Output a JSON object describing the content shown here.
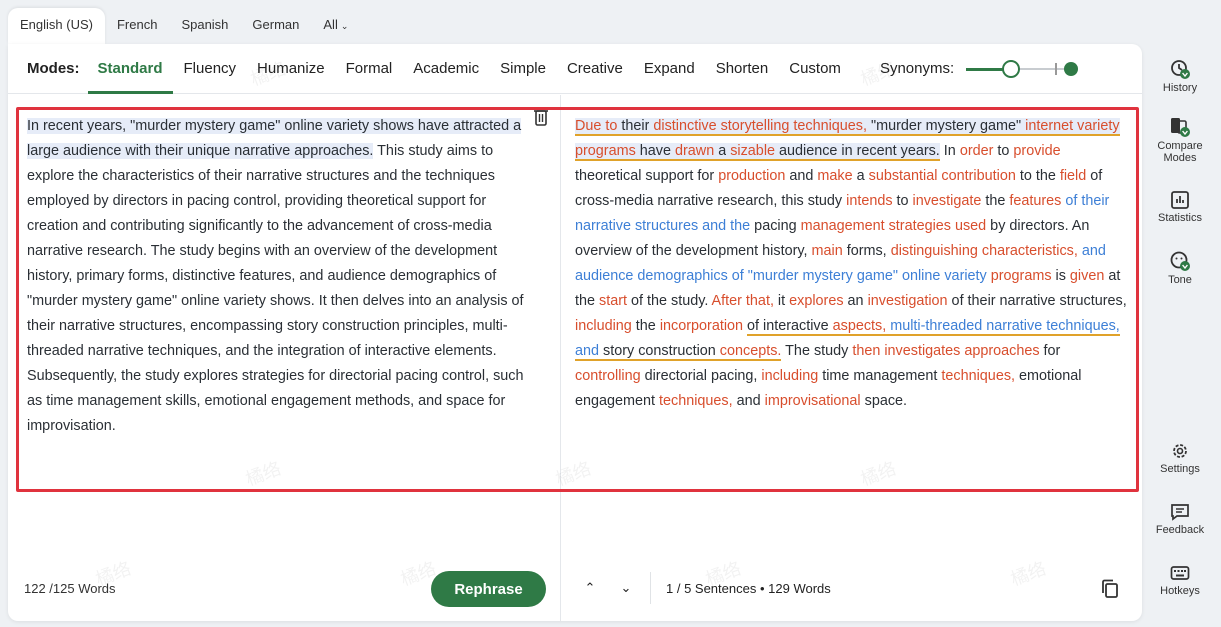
{
  "language_tabs": {
    "items": [
      "English (US)",
      "French",
      "Spanish",
      "German"
    ],
    "all_label": "All"
  },
  "modes": {
    "label": "Modes:",
    "items": [
      "Standard",
      "Fluency",
      "Humanize",
      "Formal",
      "Academic",
      "Simple",
      "Creative",
      "Expand",
      "Shorten",
      "Custom"
    ],
    "synonyms_label": "Synonyms:",
    "synonyms_level": 0.4
  },
  "input": {
    "highlight": "In recent years, \"murder mystery game\" online variety shows have attracted a large audience with their unique narrative approaches.",
    "rest": " This study aims to explore the characteristics of their narrative structures and the techniques employed by directors in pacing control, providing theoretical support for creation and contributing significantly to the advancement of cross-media narrative research. The study begins with an overview of the development history, primary forms, distinctive features, and audience demographics of \"murder mystery game\" online variety shows. It then delves into an analysis of their narrative structures, encompassing story construction principles, multi-threaded narrative techniques, and the integration of interactive elements. Subsequently, the study explores strategies for directorial pacing control, such as time management skills, emotional engagement methods, and space for improvisation.",
    "word_count": "122 /125 Words"
  },
  "output_segments": [
    [
      "Due to",
      "c",
      1
    ],
    [
      " ",
      "",
      1
    ],
    [
      "their",
      "",
      1
    ],
    [
      " ",
      "",
      1
    ],
    [
      "distinctive storytelling techniques,",
      "c",
      1
    ],
    [
      " ",
      "",
      1
    ],
    [
      "\"murder mystery game\"",
      "",
      1
    ],
    [
      " ",
      "",
      1
    ],
    [
      "internet variety",
      "c",
      1
    ],
    [
      " ",
      "",
      1
    ],
    [
      "programs",
      "c",
      1
    ],
    [
      " ",
      "",
      1
    ],
    [
      "have",
      "",
      1
    ],
    [
      " ",
      "",
      1
    ],
    [
      "drawn",
      "c",
      1
    ],
    [
      " ",
      "",
      1
    ],
    [
      "a",
      "",
      1
    ],
    [
      " ",
      "",
      1
    ],
    [
      "sizable",
      "c",
      1
    ],
    [
      " ",
      "",
      1
    ],
    [
      "audience in recent years.",
      "",
      1
    ],
    [
      " In ",
      "",
      0
    ],
    [
      "order",
      "c",
      0
    ],
    [
      " to ",
      "",
      0
    ],
    [
      "provide",
      "c",
      0
    ],
    [
      " theoretical support for ",
      "",
      0
    ],
    [
      "production",
      "c",
      0
    ],
    [
      " and ",
      "",
      0
    ],
    [
      "make",
      "c",
      0
    ],
    [
      " a ",
      "",
      0
    ],
    [
      "substantial contribution",
      "c",
      0
    ],
    [
      " to the ",
      "",
      0
    ],
    [
      "field",
      "c",
      0
    ],
    [
      " of cross-media narrative research, this study ",
      "",
      0
    ],
    [
      "intends",
      "c",
      0
    ],
    [
      " to ",
      "",
      0
    ],
    [
      "investigate",
      "c",
      0
    ],
    [
      " the ",
      "",
      0
    ],
    [
      "features",
      "c",
      0
    ],
    [
      " ",
      "",
      0
    ],
    [
      "of their narrative structures and the",
      "b",
      0
    ],
    [
      " pacing ",
      "",
      0
    ],
    [
      "management strategies used",
      "c",
      0
    ],
    [
      " by directors. An overview of the development history, ",
      "",
      0
    ],
    [
      "main",
      "c",
      0
    ],
    [
      " forms, ",
      "",
      0
    ],
    [
      "distinguishing characteristics,",
      "c",
      0
    ],
    [
      " ",
      "",
      0
    ],
    [
      "and audience demographics of \"murder mystery game\" online variety",
      "b",
      0
    ],
    [
      " ",
      "",
      0
    ],
    [
      "programs",
      "c",
      0
    ],
    [
      " is ",
      "",
      0
    ],
    [
      "given",
      "c",
      0
    ],
    [
      " at the ",
      "",
      0
    ],
    [
      "start",
      "c",
      0
    ],
    [
      " of the study. ",
      "",
      0
    ],
    [
      "After that,",
      "c",
      0
    ],
    [
      " it ",
      "",
      0
    ],
    [
      "explores",
      "c",
      0
    ],
    [
      " an ",
      "",
      0
    ],
    [
      "investigation",
      "c",
      0
    ],
    [
      " of their narrative structures, ",
      "",
      0
    ],
    [
      "including",
      "c",
      0
    ],
    [
      " the ",
      "",
      0
    ],
    [
      "incorporation",
      "c",
      0
    ],
    [
      " ",
      "",
      0
    ],
    [
      "of interactive",
      "",
      2
    ],
    [
      " ",
      "",
      2
    ],
    [
      "aspects,",
      "c",
      2
    ],
    [
      " ",
      "",
      2
    ],
    [
      "multi-threaded narrative techniques, and",
      "b",
      2
    ],
    [
      " story construction ",
      "",
      2
    ],
    [
      "concepts.",
      "c",
      2
    ],
    [
      " The study ",
      "",
      0
    ],
    [
      "then investigates approaches",
      "c",
      0
    ],
    [
      " for ",
      "",
      0
    ],
    [
      "controlling",
      "c",
      0
    ],
    [
      " directorial pacing, ",
      "",
      0
    ],
    [
      "including",
      "c",
      0
    ],
    [
      " time management ",
      "",
      0
    ],
    [
      "techniques,",
      "c",
      0
    ],
    [
      " emotional engagement ",
      "",
      0
    ],
    [
      "techniques,",
      "c",
      0
    ],
    [
      " and ",
      "",
      0
    ],
    [
      "improvisational",
      "c",
      0
    ],
    [
      " space.",
      "",
      0
    ]
  ],
  "footer": {
    "rephrase_label": "Rephrase",
    "sentences": "1 / 5 Sentences",
    "words": "129 Words"
  },
  "sidebar": {
    "history": "History",
    "compare": "Compare Modes",
    "statistics": "Statistics",
    "tone": "Tone",
    "settings": "Settings",
    "feedback": "Feedback",
    "hotkeys": "Hotkeys"
  },
  "watermark": "橘络"
}
